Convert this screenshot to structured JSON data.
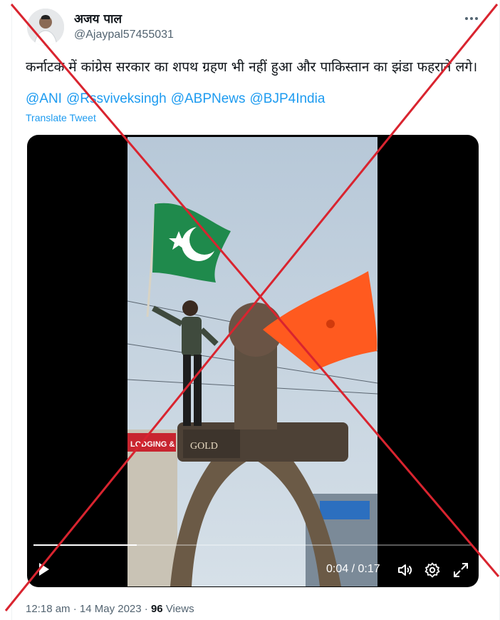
{
  "author": {
    "display_name": "अजय पाल",
    "handle": "@Ajaypal57455031"
  },
  "tweet": {
    "text": "कर्नाटक में कांग्रेस सरकार का शपथ ग्रहण भी नहीं हुआ और पाकिस्तान का झंडा फहराने लगे।",
    "mentions": [
      "@ANI",
      "@Rssviveksingh",
      "@ABPNews",
      "@BJP4India"
    ],
    "translate_label": "Translate Tweet"
  },
  "video": {
    "current_time": "0:04",
    "duration": "0:17",
    "progress": 0.235,
    "sign_text": "GOLD",
    "shop_sign": "LODGING & BO"
  },
  "meta": {
    "time": "12:18 am",
    "separator": "·",
    "date": "14 May 2023",
    "views_count": "96",
    "views_label": "Views"
  },
  "icons": [
    "more-icon",
    "play-icon",
    "volume-icon",
    "settings-icon",
    "fullscreen-icon"
  ],
  "colors": {
    "link": "#1d9bf0",
    "secondary_text": "#536471",
    "cross_mark": "#d9242f",
    "green_flag": "#1f8a4c",
    "orange_flag": "#ff5a1f"
  }
}
